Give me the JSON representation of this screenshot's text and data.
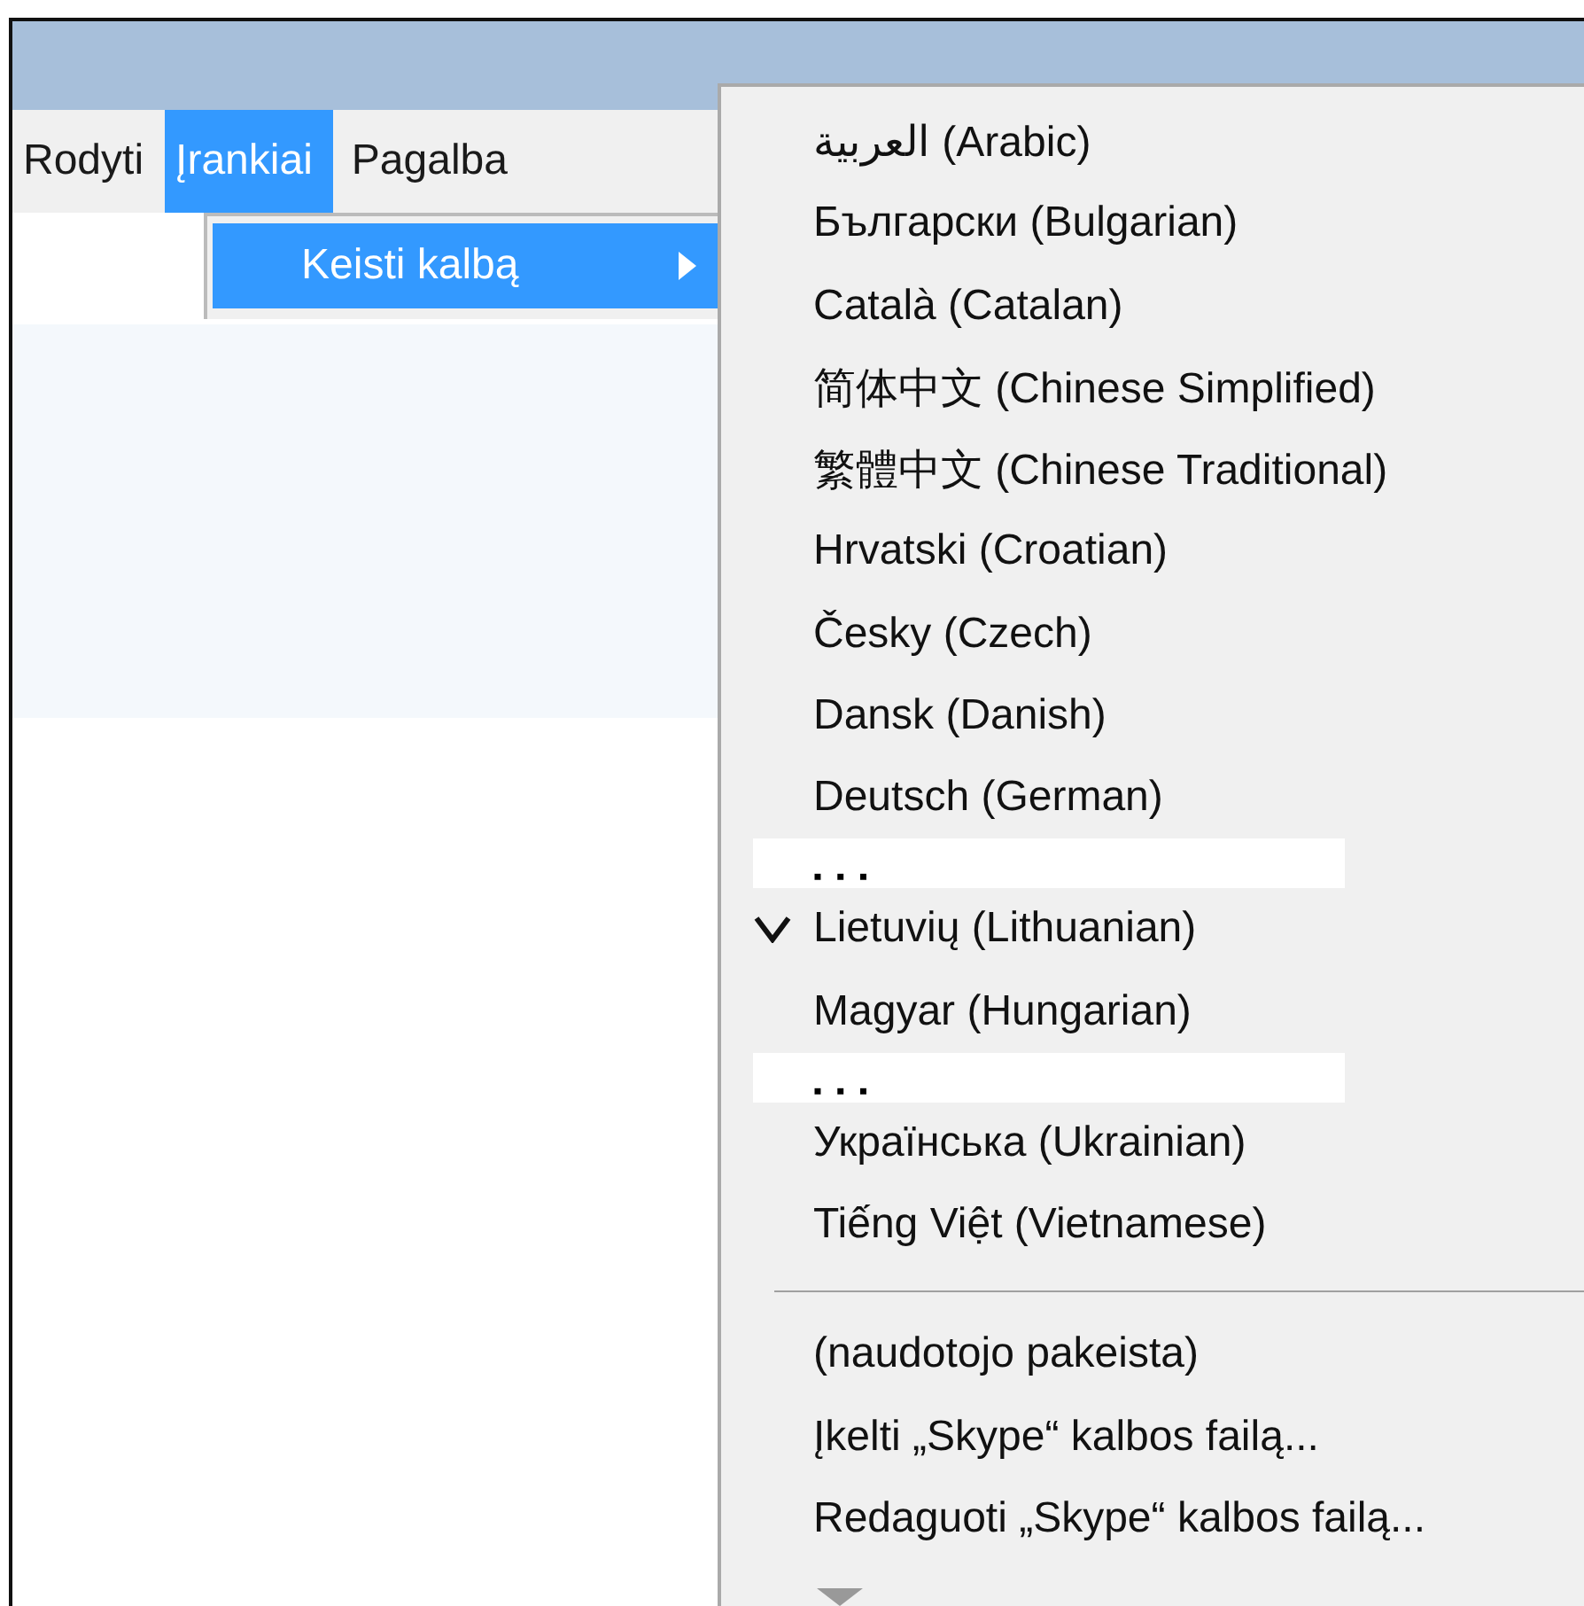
{
  "menu_bar": [
    {
      "label": "Rodyti",
      "selected": false
    },
    {
      "label": "Įrankiai",
      "selected": true
    },
    {
      "label": "Pagalba",
      "selected": false
    }
  ],
  "submenu": [
    {
      "label": "Keisti kalbą",
      "selected": true,
      "has_submenu": true
    }
  ],
  "language_menu": [
    {
      "kind": "item",
      "label": "العربية (Arabic)",
      "checked": false
    },
    {
      "kind": "item",
      "label": "Български (Bulgarian)",
      "checked": false
    },
    {
      "kind": "item",
      "label": "Català (Catalan)",
      "checked": false
    },
    {
      "kind": "item",
      "label": "简体中文 (Chinese Simplified)",
      "checked": false
    },
    {
      "kind": "item",
      "label": "繁體中文 (Chinese Traditional)",
      "checked": false
    },
    {
      "kind": "item",
      "label": "Hrvatski (Croatian)",
      "checked": false
    },
    {
      "kind": "item",
      "label": "Česky (Czech)",
      "checked": false
    },
    {
      "kind": "item",
      "label": "Dansk (Danish)",
      "checked": false
    },
    {
      "kind": "item",
      "label": "Deutsch (German)",
      "checked": false
    },
    {
      "kind": "gap",
      "label": "▪ ▪ ▪"
    },
    {
      "kind": "item",
      "label": "Lietuvių (Lithuanian)",
      "checked": true
    },
    {
      "kind": "item",
      "label": "Magyar (Hungarian)",
      "checked": false
    },
    {
      "kind": "gap",
      "label": "▪ ▪ ▪"
    },
    {
      "kind": "item",
      "label": "Українська (Ukrainian)",
      "checked": false
    },
    {
      "kind": "item",
      "label": "Tiếng Việt (Vietnamese)",
      "checked": false
    },
    {
      "kind": "separator"
    },
    {
      "kind": "item",
      "label": " (naudotojo pakeista)",
      "checked": false
    },
    {
      "kind": "item",
      "label": "Įkelti „Skype“ kalbos failą...",
      "checked": false
    },
    {
      "kind": "item",
      "label": "Redaguoti „Skype“ kalbos failą...",
      "checked": false
    }
  ],
  "more_below": true
}
